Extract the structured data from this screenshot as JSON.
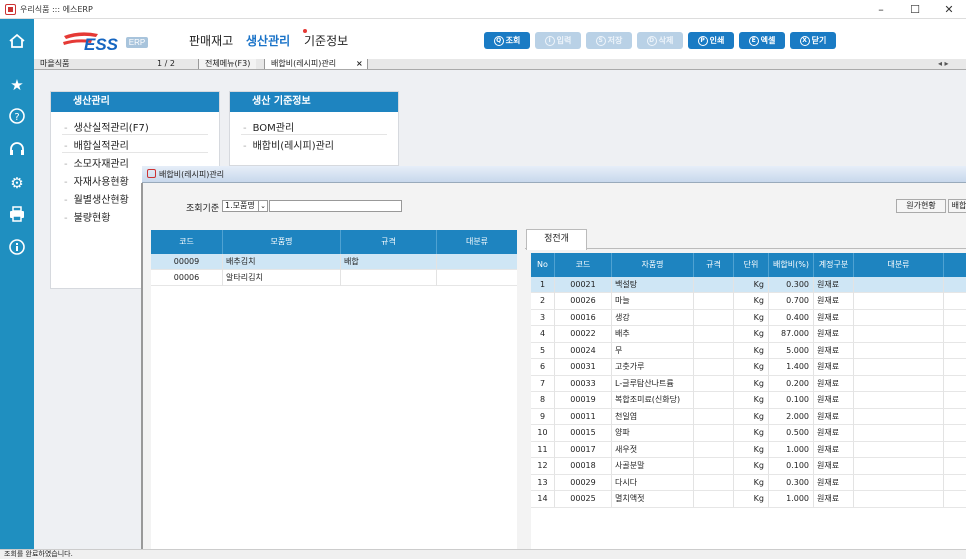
{
  "window": {
    "title": "우리식품 ::: 에스ERP",
    "minimize": "–",
    "maximize": "☐",
    "close": "✕"
  },
  "sidebar": {
    "icons": [
      "home-icon",
      "star-icon",
      "help-icon",
      "headset-icon",
      "settings-icon",
      "printer-icon",
      "info-icon"
    ]
  },
  "logo": {
    "text": "ESS",
    "badge": "ERP"
  },
  "top_menu": {
    "items": [
      "판매재고",
      "생산관리",
      "기준정보"
    ]
  },
  "toolbar": {
    "buttons": [
      {
        "key": "Q",
        "label": "조회",
        "enabled": true
      },
      {
        "key": "I",
        "label": "입력",
        "enabled": false
      },
      {
        "key": "S",
        "label": "저장",
        "enabled": false
      },
      {
        "key": "D",
        "label": "삭제",
        "enabled": false
      },
      {
        "key": "P",
        "label": "인쇄",
        "enabled": true
      },
      {
        "key": "E",
        "label": "엑셀",
        "enabled": true
      },
      {
        "key": "X",
        "label": "닫기",
        "enabled": true
      }
    ]
  },
  "tabstrip": {
    "company": "마을식품",
    "page": "1 / 2",
    "tabs": [
      "전체메뉴(F3)",
      "배합비(레시피)관리"
    ],
    "close": "×",
    "nav": "◂ ▸"
  },
  "menus": {
    "production": {
      "title": "생산관리",
      "items": [
        "생산실적관리(F7)",
        "배합실적관리",
        "소모자재관리",
        "자재사용현황",
        "월별생산현황",
        "불량현황"
      ]
    },
    "standards": {
      "title": "생산 기준정보",
      "items": [
        "BOM관리",
        "배합비(레시피)관리"
      ]
    }
  },
  "popup": {
    "title": "배합비(레시피)관리",
    "search_label": "조회기준",
    "search_select": "1.모품명",
    "search_value": "",
    "cost_button": "원가현황",
    "mix_button": "배합",
    "left_grid": {
      "headers": [
        "코드",
        "모품명",
        "규격",
        "대분류"
      ],
      "rows": [
        [
          "00009",
          "배추김치",
          "배합",
          ""
        ],
        [
          "00006",
          "알타리김치",
          "",
          ""
        ]
      ]
    },
    "right_tab": "정전개",
    "right_grid": {
      "headers": [
        "No",
        "코드",
        "자품명",
        "규격",
        "단위",
        "배합비(%)",
        "계정구분",
        "대분류"
      ],
      "rows": [
        [
          "1",
          "00021",
          "백설탕",
          "",
          "Kg",
          "0.300",
          "원재료",
          ""
        ],
        [
          "2",
          "00026",
          "마늘",
          "",
          "Kg",
          "0.700",
          "원재료",
          ""
        ],
        [
          "3",
          "00016",
          "생강",
          "",
          "Kg",
          "0.400",
          "원재료",
          ""
        ],
        [
          "4",
          "00022",
          "배추",
          "",
          "Kg",
          "87.000",
          "원재료",
          ""
        ],
        [
          "5",
          "00024",
          "무",
          "",
          "Kg",
          "5.000",
          "원재료",
          ""
        ],
        [
          "6",
          "00031",
          "고춧가루",
          "",
          "Kg",
          "1.400",
          "원재료",
          ""
        ],
        [
          "7",
          "00033",
          "L-글루탐산나트륨",
          "",
          "Kg",
          "0.200",
          "원재료",
          ""
        ],
        [
          "8",
          "00019",
          "복합조미료(신화당)",
          "",
          "Kg",
          "0.100",
          "원재료",
          ""
        ],
        [
          "9",
          "00011",
          "천일염",
          "",
          "Kg",
          "2.000",
          "원재료",
          ""
        ],
        [
          "10",
          "00015",
          "양파",
          "",
          "Kg",
          "0.500",
          "원재료",
          ""
        ],
        [
          "11",
          "00017",
          "새우젓",
          "",
          "Kg",
          "1.000",
          "원재료",
          ""
        ],
        [
          "12",
          "00018",
          "사골분말",
          "",
          "Kg",
          "0.100",
          "원재료",
          ""
        ],
        [
          "13",
          "00029",
          "다시다",
          "",
          "Kg",
          "0.300",
          "원재료",
          ""
        ],
        [
          "14",
          "00025",
          "멸치액젓",
          "",
          "Kg",
          "1.000",
          "원재료",
          ""
        ]
      ]
    }
  },
  "status": {
    "text": "조회를 완료하였습니다."
  },
  "colors": {
    "accent": "#1e84c0",
    "sidebar": "#1f8fc0",
    "selected_row": "#cfe6f5"
  }
}
